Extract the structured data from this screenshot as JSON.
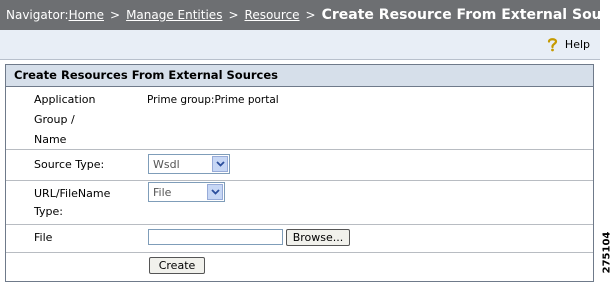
{
  "navigator": {
    "prefix": "Navigator:",
    "crumbs": [
      "Home",
      "Manage Entities",
      "Resource"
    ],
    "separator": ">",
    "current": "Create Resource From External Sources"
  },
  "help": {
    "label": "Help",
    "icon": "help-question-icon"
  },
  "panel": {
    "title": "Create Resources From External Sources",
    "app_label_line1": "Application",
    "app_label_line2": "Group /",
    "app_label_line3": "Name",
    "app_value": "Prime group:Prime portal",
    "source_type_label": "Source Type:",
    "source_type_value": "Wsdl",
    "url_label_line1": "URL/FileName",
    "url_label_line2": "Type:",
    "url_type_value": "File",
    "file_label": "File",
    "file_value": "",
    "browse_label": "Browse...",
    "create_label": "Create"
  },
  "figure_id": "275104",
  "colors": {
    "nav_bg": "#6d6f72",
    "helpbar_bg": "#e8eef6",
    "panel_title_bg": "#d6dfea",
    "help_icon": "#c69a00"
  }
}
